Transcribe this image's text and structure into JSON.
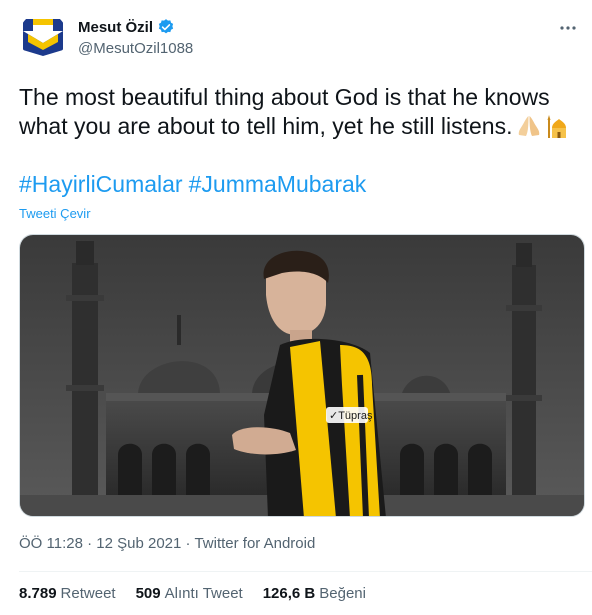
{
  "author": {
    "name": "Mesut Özil",
    "handle": "@MesutOzil1088"
  },
  "tweet": {
    "text": "The most beautiful thing about God is that he knows what you are about to tell him, yet he still listens.",
    "hashtags": [
      "#HayirliCumalar",
      "#JummaMubarak"
    ],
    "translate_label": "Tweeti Çevir"
  },
  "meta": {
    "time": "ÖÖ 11:28",
    "date": "12 Şub 2021",
    "source": "Twitter for Android"
  },
  "stats": {
    "retweets": "8.789",
    "retweets_label": "Retweet",
    "quotes": "509",
    "quotes_label": "Alıntı Tweet",
    "likes": "126,6 B",
    "likes_label": "Beğeni"
  },
  "colors": {
    "link": "#1d9bf0",
    "secondary_text": "#536471",
    "verified": "#1d9bf0",
    "jersey_yellow": "#f5c400"
  },
  "icons": [
    "logo-avatar-icon",
    "verified-badge-icon",
    "more-options-icon",
    "praying-hands-icon",
    "mosque-icon"
  ]
}
